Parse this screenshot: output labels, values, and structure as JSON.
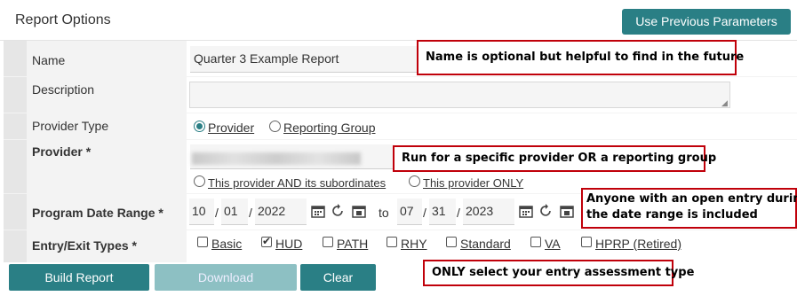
{
  "header": {
    "title": "Report Options",
    "prev_params_label": "Use Previous Parameters"
  },
  "form": {
    "name_label": "Name",
    "name_value": "Quarter 3 Example Report",
    "description_label": "Description",
    "description_value": "",
    "provider_type_label": "Provider Type",
    "provider_type_options": [
      "Provider",
      "Reporting Group"
    ],
    "provider_label": "Provider *",
    "provider_scope_options": [
      "This provider AND its subordinates",
      "This provider ONLY"
    ],
    "date_range_label": "Program Date Range *",
    "start_month": "10",
    "start_day": "01",
    "start_year": "2022",
    "to_label": "to",
    "end_month": "07",
    "end_day": "31",
    "end_year": "2023",
    "entry_exit_label": "Entry/Exit Types *",
    "entry_exit_types": [
      "Basic",
      "HUD",
      "PATH",
      "RHY",
      "Standard",
      "VA",
      "HPRP (Retired)"
    ],
    "entry_exit_checked": "HUD"
  },
  "buttons": {
    "build": "Build Report",
    "download": "Download",
    "clear": "Clear"
  },
  "callouts": {
    "name_note": "Name is optional but helpful to find in the future",
    "provider_note": "Run for a specific provider OR a reporting group",
    "date_note_line1": "Anyone with an open entry during",
    "date_note_line2": "the date range is included",
    "type_note": "ONLY select your entry assessment type"
  },
  "colors": {
    "accent": "#2a7f85",
    "callout_border": "#c0000a"
  }
}
